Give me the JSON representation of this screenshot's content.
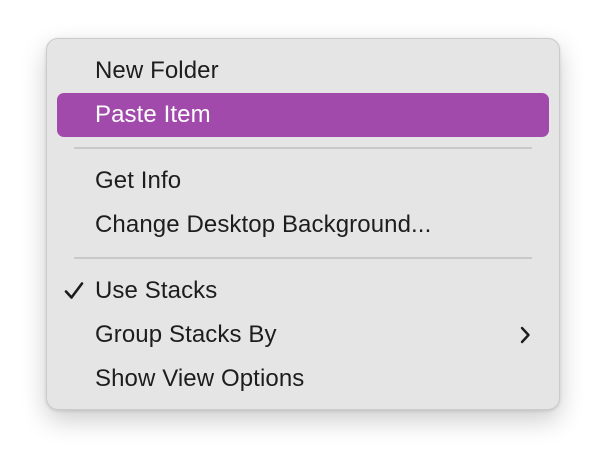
{
  "menu": {
    "items": [
      {
        "type": "item",
        "name": "menu-item-new-folder",
        "label": "New Folder"
      },
      {
        "type": "item",
        "name": "menu-item-paste-item",
        "label": "Paste Item",
        "selected": true
      },
      {
        "type": "separator"
      },
      {
        "type": "item",
        "name": "menu-item-get-info",
        "label": "Get Info"
      },
      {
        "type": "item",
        "name": "menu-item-change-desktop-background",
        "label": "Change Desktop Background..."
      },
      {
        "type": "separator"
      },
      {
        "type": "item",
        "name": "menu-item-use-stacks",
        "label": "Use Stacks",
        "checked": true
      },
      {
        "type": "item",
        "name": "menu-item-group-stacks-by",
        "label": "Group Stacks By",
        "submenu": true
      },
      {
        "type": "item",
        "name": "menu-item-show-view-options",
        "label": "Show View Options"
      }
    ]
  },
  "icons": {
    "check": "checkmark-icon",
    "submenu": "chevron-right-icon"
  },
  "colors": {
    "highlight": "#a24aab",
    "menu_background": "#e5e5e5",
    "text": "#1d1d1d",
    "separator": "#c9c9c9"
  }
}
